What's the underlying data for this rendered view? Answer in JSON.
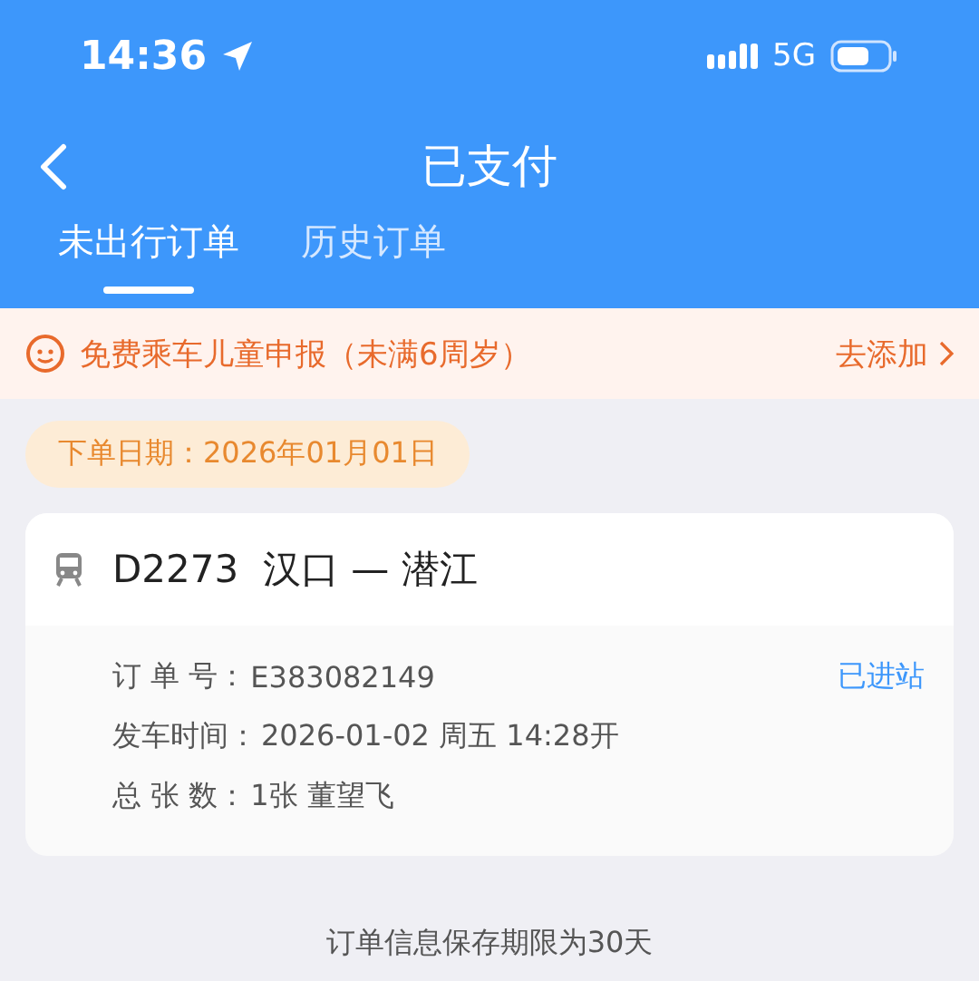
{
  "status_bar": {
    "time": "14:36",
    "network": "5G"
  },
  "header": {
    "title": "已支付"
  },
  "tabs": [
    {
      "label": "未出行订单",
      "selected": true
    },
    {
      "label": "历史订单",
      "selected": false
    }
  ],
  "notice": {
    "text": "免费乘车儿童申报（未满6周岁）",
    "action": "去添加"
  },
  "order_date": "下单日期：2026年01月01日",
  "order": {
    "train": "D2273",
    "route": "汉口 — 潜江",
    "status": "已进站",
    "fields": [
      {
        "label": "订 单 号：",
        "value": "E383082149"
      },
      {
        "label": "发车时间：",
        "value": "2026-01-02 周五 14:28开"
      },
      {
        "label": "总 张 数：",
        "value": "1张 董望飞"
      }
    ]
  },
  "footer": "订单信息保存期限为30天"
}
